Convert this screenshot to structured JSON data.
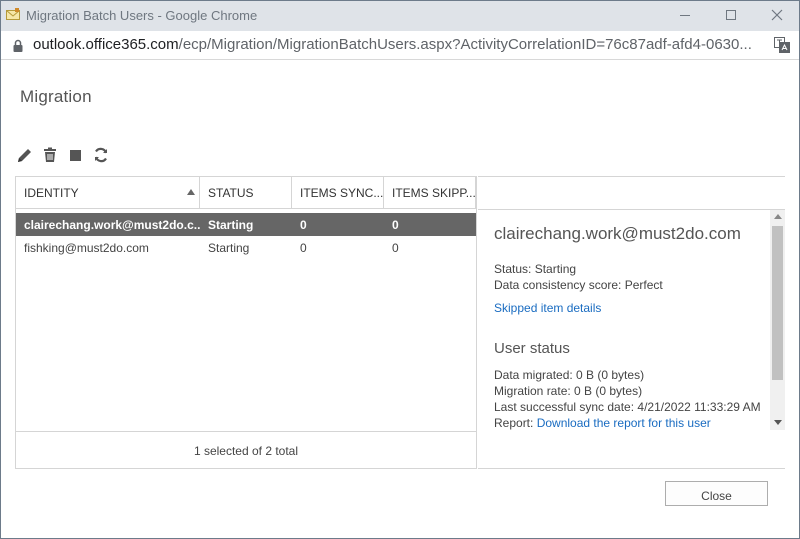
{
  "window": {
    "title": "Migration Batch Users - Google Chrome",
    "icon": "envelope-icon"
  },
  "address_bar": {
    "host": "outlook.office365.com",
    "path": "/ecp/Migration/MigrationBatchUsers.aspx?ActivityCorrelationID=76c87adf-afd4-0630..."
  },
  "page": {
    "title": "Migration"
  },
  "toolbar": {
    "icons": [
      "pencil-icon",
      "trash-icon",
      "stop-icon",
      "refresh-icon"
    ]
  },
  "list": {
    "columns": [
      "IDENTITY",
      "STATUS",
      "ITEMS SYNC...",
      "ITEMS SKIPP..."
    ],
    "sort_column": "IDENTITY",
    "sort_direction": "ascending",
    "rows": [
      {
        "identity": "clairechang.work@must2do.c...",
        "status": "Starting",
        "items_synced": "0",
        "items_skipped": "0",
        "selected": true
      },
      {
        "identity": "fishking@must2do.com",
        "status": "Starting",
        "items_synced": "0",
        "items_skipped": "0",
        "selected": false
      }
    ],
    "footer": "1 selected of 2 total"
  },
  "details": {
    "name": "clairechang.work@must2do.com",
    "status": "Status: Starting",
    "consistency": "Data consistency score: Perfect",
    "skipped_link": "Skipped item details",
    "section_title": "User status",
    "data_migrated": "Data migrated: 0 B (0 bytes)",
    "migration_rate": "Migration rate: 0 B (0 bytes)",
    "last_sync": "Last successful sync date: 4/21/2022 11:33:29 AM",
    "report_label": "Report: ",
    "report_link": "Download the report for this user"
  },
  "buttons": {
    "close": "Close"
  },
  "colors": {
    "selected_row": "#666666",
    "link": "#1a6cc1",
    "titlebar": "#dfe3e8"
  }
}
